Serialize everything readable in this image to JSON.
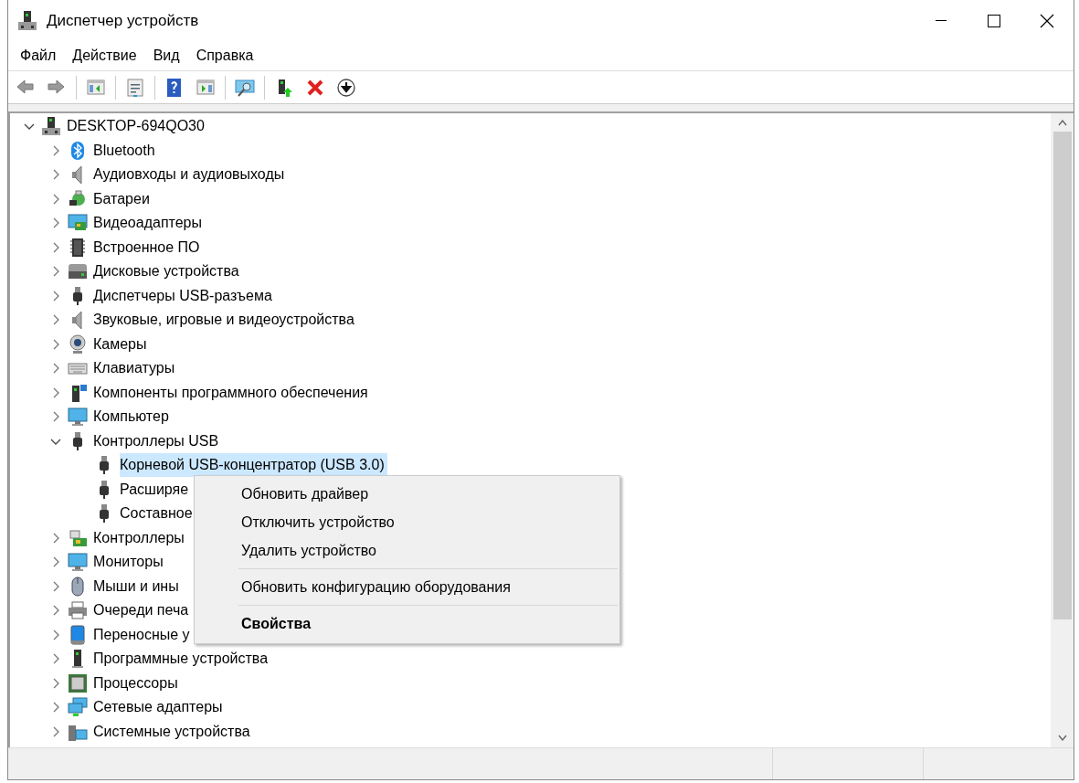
{
  "window": {
    "title": "Диспетчер устройств"
  },
  "menu": [
    "Файл",
    "Действие",
    "Вид",
    "Справка"
  ],
  "tree": {
    "label": "DESKTOP-694QO30",
    "expanded": true,
    "selected": false,
    "children": [
      {
        "label": "Bluetooth",
        "expanded": false,
        "selected": false
      },
      {
        "label": "Аудиовходы и аудиовыходы",
        "expanded": false,
        "selected": false
      },
      {
        "label": "Батареи",
        "expanded": false,
        "selected": false
      },
      {
        "label": "Видеоадаптеры",
        "expanded": false,
        "selected": false
      },
      {
        "label": "Встроенное ПО",
        "expanded": false,
        "selected": false
      },
      {
        "label": "Дисковые устройства",
        "expanded": false,
        "selected": false
      },
      {
        "label": "Диспетчеры USB-разъема",
        "expanded": false,
        "selected": false
      },
      {
        "label": "Звуковые, игровые и видеоустройства",
        "expanded": false,
        "selected": false
      },
      {
        "label": "Камеры",
        "expanded": false,
        "selected": false
      },
      {
        "label": "Клавиатуры",
        "expanded": false,
        "selected": false
      },
      {
        "label": "Компоненты программного обеспечения",
        "expanded": false,
        "selected": false
      },
      {
        "label": "Компьютер",
        "expanded": false,
        "selected": false
      },
      {
        "label": "Контроллеры USB",
        "expanded": true,
        "selected": false,
        "children": [
          {
            "label": "Корневой USB-концентратор (USB 3.0)",
            "selected": true
          },
          {
            "label": "Расширяе",
            "selected": false
          },
          {
            "label": "Составное",
            "selected": false
          }
        ]
      },
      {
        "label": "Контроллеры",
        "expanded": false,
        "selected": false
      },
      {
        "label": "Мониторы",
        "expanded": false,
        "selected": false
      },
      {
        "label": "Мыши и ины",
        "expanded": false,
        "selected": false
      },
      {
        "label": "Очереди печа",
        "expanded": false,
        "selected": false
      },
      {
        "label": "Переносные у",
        "expanded": false,
        "selected": false
      },
      {
        "label": "Программные устройства",
        "expanded": false,
        "selected": false
      },
      {
        "label": "Процессоры",
        "expanded": false,
        "selected": false
      },
      {
        "label": "Сетевые адаптеры",
        "expanded": false,
        "selected": false
      },
      {
        "label": "Системные устройства",
        "expanded": false,
        "selected": false
      }
    ]
  },
  "context_menu": [
    {
      "kind": "item",
      "label": "Обновить драйвер",
      "bold": false
    },
    {
      "kind": "item",
      "label": "Отключить устройство",
      "bold": false
    },
    {
      "kind": "item",
      "label": "Удалить устройство",
      "bold": false
    },
    {
      "kind": "separator"
    },
    {
      "kind": "item",
      "label": "Обновить конфигурацию оборудования",
      "bold": false
    },
    {
      "kind": "separator"
    },
    {
      "kind": "item",
      "label": "Свойства",
      "bold": true
    }
  ]
}
